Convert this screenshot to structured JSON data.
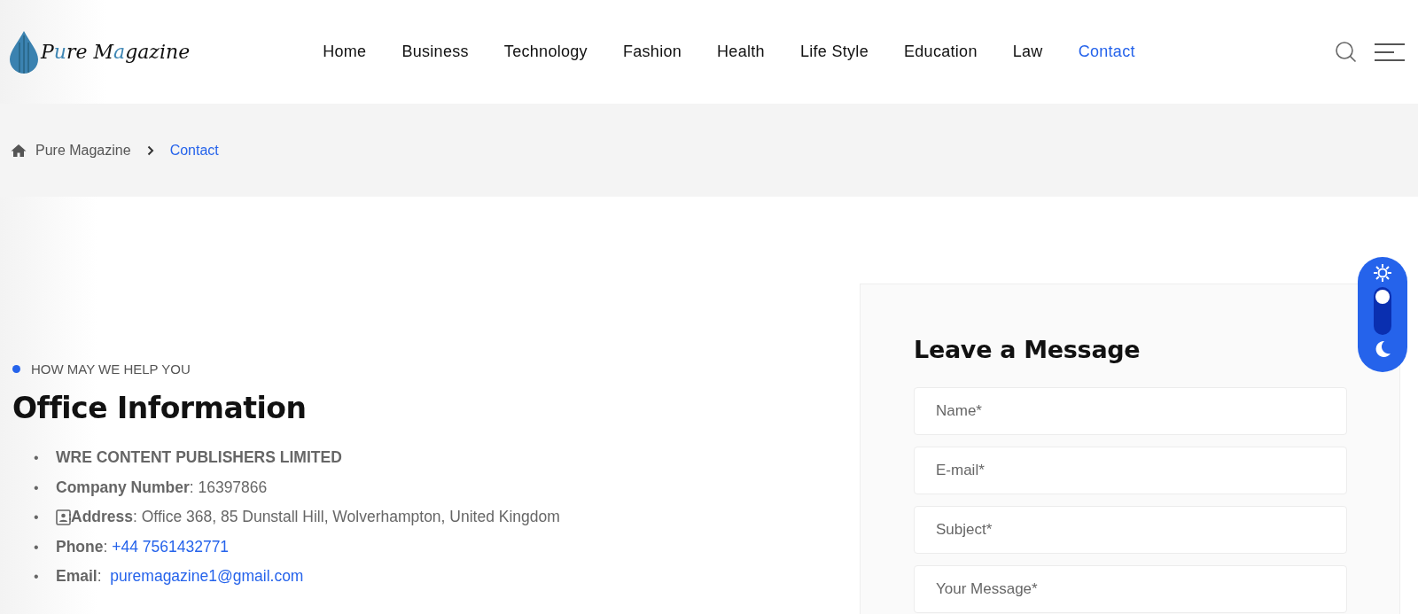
{
  "logo": {
    "parts": [
      {
        "text": "P",
        "accent": false
      },
      {
        "text": "u",
        "accent": true
      },
      {
        "text": "re M",
        "accent": false
      },
      {
        "text": "a",
        "accent": true
      },
      {
        "text": "gazine",
        "accent": false
      }
    ]
  },
  "nav": [
    {
      "label": "Home",
      "selected": false
    },
    {
      "label": "Business",
      "selected": false
    },
    {
      "label": "Technology",
      "selected": false
    },
    {
      "label": "Fashion",
      "selected": false
    },
    {
      "label": "Health",
      "selected": false
    },
    {
      "label": "Life Style",
      "selected": false
    },
    {
      "label": "Education",
      "selected": false
    },
    {
      "label": "Law",
      "selected": false
    },
    {
      "label": "Contact",
      "selected": true
    }
  ],
  "breadcrumb": [
    {
      "label": "Pure Magazine",
      "selected": false
    },
    {
      "label": "Contact",
      "selected": true
    }
  ],
  "office": {
    "eyebrow": "HOW MAY WE HELP YOU",
    "title": "Office Information",
    "items": [
      {
        "kind": "plain",
        "marker": "•",
        "text": "**WRE CONTENT PUBLISHERS LIMITED**"
      },
      {
        "kind": "plain",
        "marker": "•",
        "text": "**Company Number**: 16397866"
      },
      {
        "kind": "card",
        "marker": "•",
        "text": "**Address**: Office 368, 85 Dunstall Hill, Wolverhampton, United Kingdom"
      },
      {
        "kind": "plain",
        "marker": "•",
        "text": "**Phone**: ",
        "link": "+44 7561432771"
      },
      {
        "kind": "plain",
        "marker": "•",
        "text": "**Email**:  ",
        "link": "puremagazine1@gmail.com"
      }
    ]
  },
  "form": {
    "title": "Leave a Message",
    "fields": [
      {
        "placeholder": "Name*"
      },
      {
        "placeholder": "E-mail*"
      },
      {
        "placeholder": "Subject*"
      },
      {
        "placeholder": "Your Message*"
      }
    ]
  },
  "theme_toggle": {
    "dark": false
  }
}
